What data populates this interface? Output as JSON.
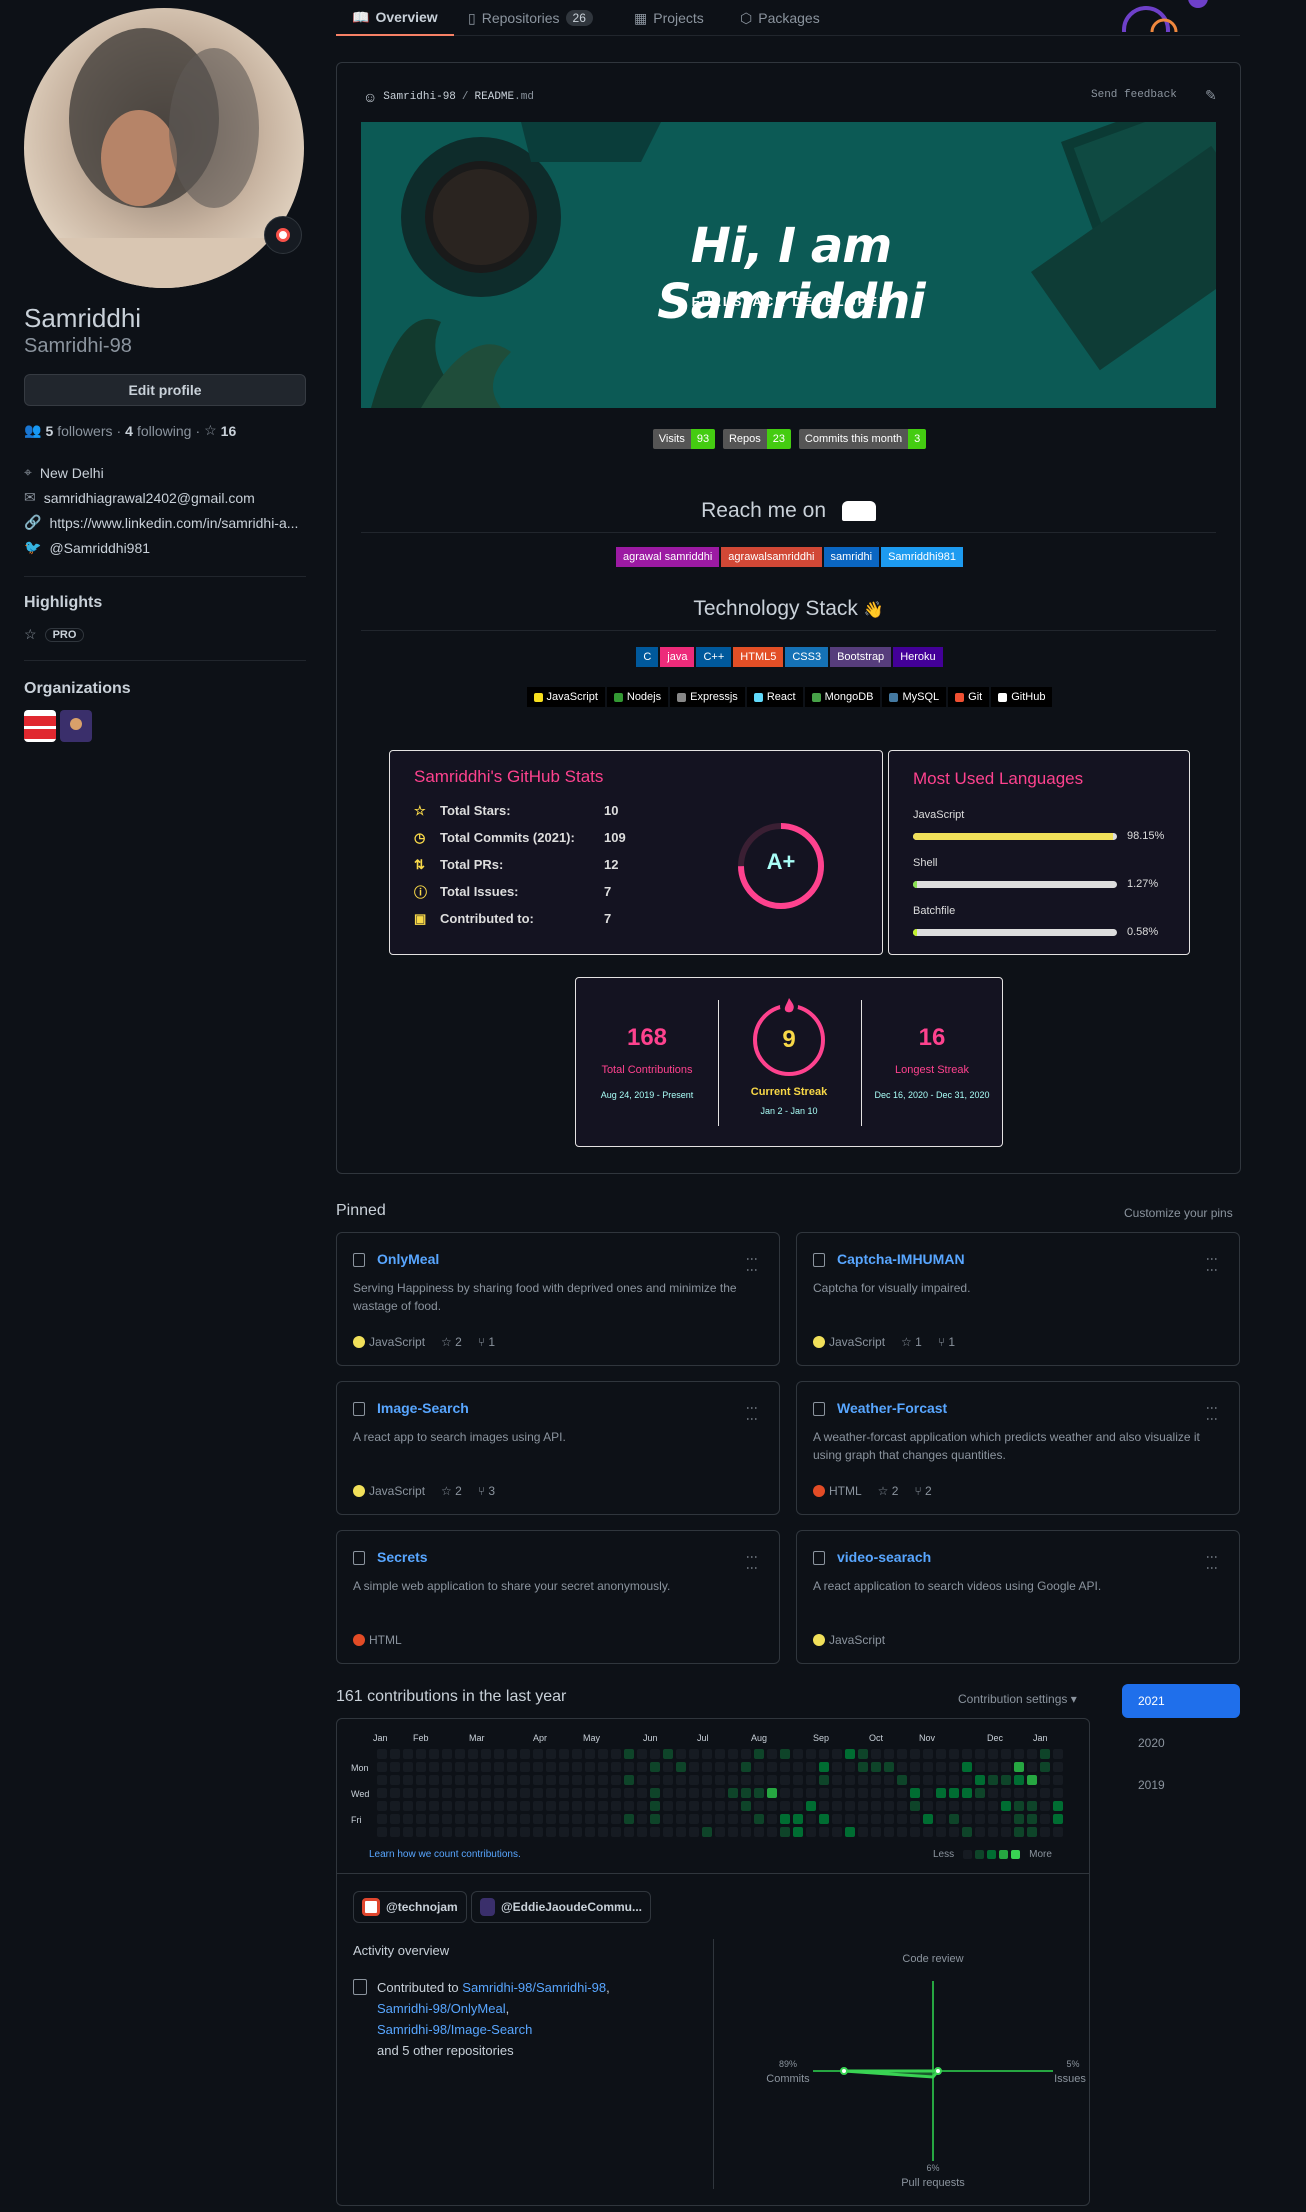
{
  "tabs": [
    {
      "label": "Overview"
    },
    {
      "label": "Repositories",
      "count": "26"
    },
    {
      "label": "Projects"
    },
    {
      "label": "Packages"
    }
  ],
  "profile": {
    "name": "Samriddhi",
    "login": "Samridhi-98",
    "edit_label": "Edit profile",
    "followers_count": "5",
    "followers_label": "followers",
    "following_count": "4",
    "following_label": "following",
    "stars": "16",
    "location": "New Delhi",
    "email": "samridhiagrawal2402@gmail.com",
    "website": "https://www.linkedin.com/in/samridhi-a...",
    "twitter": "@Samriddhi981",
    "highlights_title": "Highlights",
    "pro_label": "PRO",
    "orgs_title": "Organizations"
  },
  "readme": {
    "path_user": "Samridhi-98",
    "path_sep": " / ",
    "path_file": "README",
    "path_ext": ".md",
    "feedback": "Send feedback",
    "banner_title": "Hi, I am Samriddhi",
    "banner_sub": "FULLSTACK DEVELOPER",
    "badges": [
      {
        "l": "Visits",
        "r": "93"
      },
      {
        "l": "Repos",
        "r": "23"
      },
      {
        "l": "Commits this month",
        "r": "3"
      }
    ],
    "reach_title": "Reach me on",
    "social": [
      {
        "label": "agrawal samriddhi",
        "color": "#9c1aa3"
      },
      {
        "label": "agrawalsamriddhi",
        "color": "#d14836"
      },
      {
        "label": "samridhi",
        "color": "#0a66c2"
      },
      {
        "label": "Samriddhi981",
        "color": "#1d9bf0"
      }
    ],
    "tech_title": "Technology Stack",
    "tech1": [
      {
        "label": "C",
        "color": "#00599c"
      },
      {
        "label": "java",
        "color": "#ed2b7a"
      },
      {
        "label": "C++",
        "color": "#00599c"
      },
      {
        "label": "HTML5",
        "color": "#e34f26"
      },
      {
        "label": "CSS3",
        "color": "#1572b6"
      },
      {
        "label": "Bootstrap",
        "color": "#563d7c"
      },
      {
        "label": "Heroku",
        "color": "#430098"
      }
    ],
    "tech2": [
      {
        "label": "JavaScript"
      },
      {
        "label": "Nodejs"
      },
      {
        "label": "Expressjs"
      },
      {
        "label": "React"
      },
      {
        "label": "MongoDB"
      },
      {
        "label": "MySQL"
      },
      {
        "label": "Git"
      },
      {
        "label": "GitHub"
      }
    ]
  },
  "stats": {
    "title": "Samriddhi's GitHub Stats",
    "grade": "A+",
    "rows": [
      {
        "label": "Total Stars:",
        "value": "10"
      },
      {
        "label": "Total Commits (2021):",
        "value": "109"
      },
      {
        "label": "Total PRs:",
        "value": "12"
      },
      {
        "label": "Total Issues:",
        "value": "7"
      },
      {
        "label": "Contributed to:",
        "value": "7"
      }
    ]
  },
  "languages": {
    "title": "Most Used Languages",
    "items": [
      {
        "name": "JavaScript",
        "pct": "98.15%",
        "frac": 0.9815,
        "color": "#f1e05a"
      },
      {
        "name": "Shell",
        "pct": "1.27%",
        "frac": 0.0127,
        "color": "#89e051"
      },
      {
        "name": "Batchfile",
        "pct": "0.58%",
        "frac": 0.0058,
        "color": "#c1f12e"
      }
    ]
  },
  "streak": {
    "total": "168",
    "total_label": "Total Contributions",
    "total_range": "Aug 24, 2019 - Present",
    "current": "9",
    "current_label": "Current Streak",
    "current_range": "Jan 2 - Jan 10",
    "longest": "16",
    "longest_label": "Longest Streak",
    "longest_range": "Dec 16, 2020 - Dec 31, 2020"
  },
  "pinned": {
    "title": "Pinned",
    "customize": "Customize your pins",
    "items": [
      {
        "name": "OnlyMeal",
        "desc": "Serving Happiness by sharing food with deprived ones and minimize the wastage of food.",
        "lang": "JavaScript",
        "color": "#f1e05a",
        "stars": "2",
        "forks": "1"
      },
      {
        "name": "Captcha-IMHUMAN",
        "desc": "Captcha for visually impaired.",
        "lang": "JavaScript",
        "color": "#f1e05a",
        "stars": "1",
        "forks": "1"
      },
      {
        "name": "Image-Search",
        "desc": "A react app to search images using API.",
        "lang": "JavaScript",
        "color": "#f1e05a",
        "stars": "2",
        "forks": "3"
      },
      {
        "name": "Weather-Forcast",
        "desc": "A weather-forcast application which predicts weather and also visualize it using graph that changes quantities.",
        "lang": "HTML",
        "color": "#e34c26",
        "stars": "2",
        "forks": "2"
      },
      {
        "name": "Secrets",
        "desc": "A simple web application to share your secret anonymously.",
        "lang": "HTML",
        "color": "#e34c26",
        "stars": "",
        "forks": ""
      },
      {
        "name": "video-searach",
        "desc": "A react application to search videos using Google API.",
        "lang": "JavaScript",
        "color": "#f1e05a",
        "stars": "",
        "forks": ""
      }
    ]
  },
  "contrib": {
    "title": "161 contributions in the last year",
    "settings": "Contribution settings ▾",
    "months": [
      "Jan",
      "Feb",
      "Mar",
      "Apr",
      "May",
      "Jun",
      "Jul",
      "Aug",
      "Sep",
      "Oct",
      "Nov",
      "Dec",
      "Jan"
    ],
    "days": [
      "Mon",
      "Wed",
      "Fri"
    ],
    "learn": "Learn how we count contributions.",
    "less": "Less",
    "more": "More",
    "years": [
      "2021",
      "2020",
      "2019"
    ]
  },
  "activity": {
    "org1": "@technojam",
    "org2": "@EddieJaoudeCommu...",
    "title": "Activity overview",
    "contributed_prefix": "Contributed to ",
    "repo1": "Samridhi-98/Samridhi-98",
    "repo2": "Samridhi-98/OnlyMeal",
    "repo3": "Samridhi-98/Image-Search",
    "others": "and 5 other repositories",
    "code_review": "Code review",
    "commits_pct": "89%",
    "commits": "Commits",
    "issues_pct": "5%",
    "issues": "Issues",
    "prs_pct": "6%",
    "prs": "Pull requests",
    "axes": {
      "commits": 0.89,
      "issues": 0.05,
      "pull_requests": 0.06,
      "code_review": 0
    }
  }
}
